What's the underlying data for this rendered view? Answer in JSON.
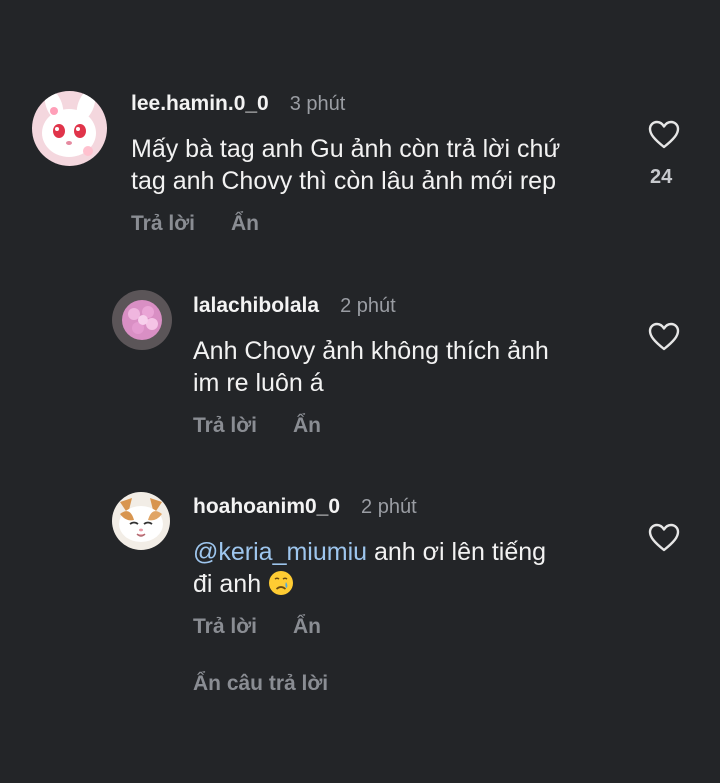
{
  "comments": [
    {
      "username": "lee.hamin.0_0",
      "time": "3 phút",
      "text_line1": "Mấy bà tag anh Gu ảnh còn trả lời chứ",
      "text_line2": "tag anh Chovy thì còn lâu ảnh mới rep",
      "reply_label": "Trả lời",
      "hide_label": "Ẩn",
      "likes": "24",
      "avatar_icon": "white-rabbit-avatar"
    },
    {
      "username": "lalachibolala",
      "time": "2 phút",
      "text_line1": "Anh Chovy ảnh không thích ảnh",
      "text_line2": "im re luôn á",
      "reply_label": "Trả lời",
      "hide_label": "Ẩn",
      "avatar_icon": "pink-flower-avatar"
    },
    {
      "username": "hoahoanim0_0",
      "time": "2 phút",
      "mention": "@keria_miumiu",
      "text_rest": " anh ơi lên tiếng",
      "text_line2": "đi anh ",
      "emoji": "crying-face-emoji",
      "reply_label": "Trả lời",
      "hide_label": "Ẩn",
      "avatar_icon": "kitten-avatar"
    }
  ],
  "hide_replies_label": "Ẩn câu trả lời",
  "colors": {
    "background": "#232528",
    "mention": "#9ec6ee",
    "muted": "#8a8d93"
  }
}
